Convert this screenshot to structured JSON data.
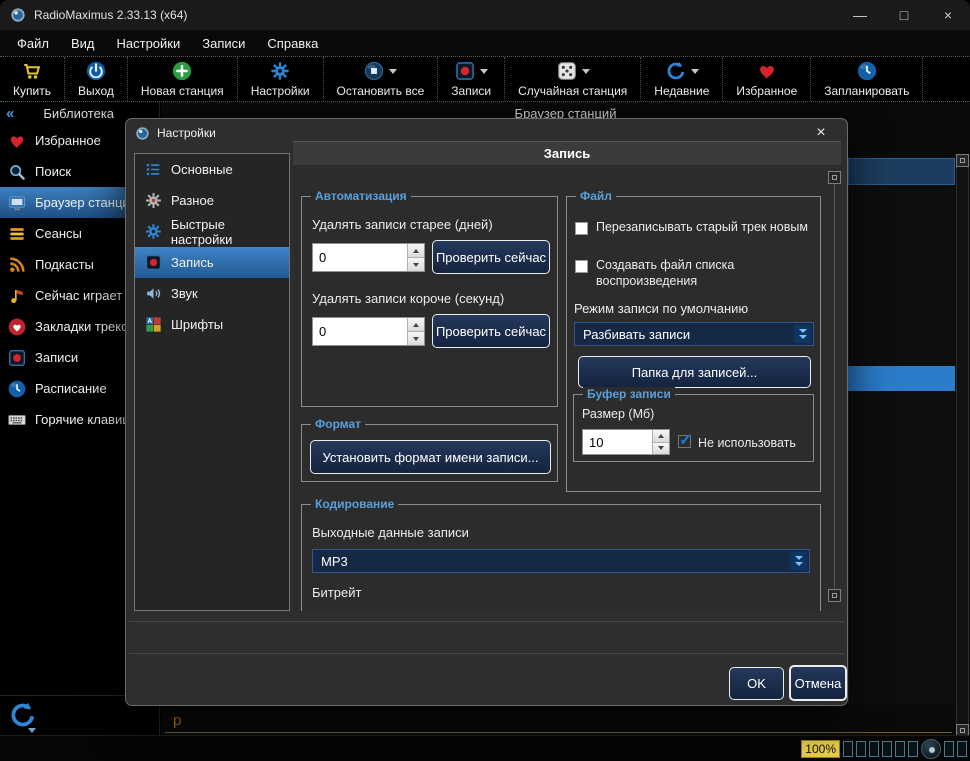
{
  "window": {
    "title": "RadioMaximus 2.33.13 (x64)",
    "minimize": "—",
    "maximize": "□",
    "close": "×"
  },
  "menubar": {
    "items": [
      {
        "label": "Файл"
      },
      {
        "label": "Вид"
      },
      {
        "label": "Настройки"
      },
      {
        "label": "Записи"
      },
      {
        "label": "Справка"
      }
    ]
  },
  "toolbar": {
    "buttons": [
      {
        "label": "Купить"
      },
      {
        "label": "Выход"
      },
      {
        "label": "Новая станция"
      },
      {
        "label": "Настройки"
      },
      {
        "label": "Остановить все",
        "dropdown": true
      },
      {
        "label": "Записи",
        "dropdown": true
      },
      {
        "label": "Случайная станция",
        "dropdown": true
      },
      {
        "label": "Недавние",
        "dropdown": true
      },
      {
        "label": "Избранное"
      },
      {
        "label": "Запланировать"
      }
    ]
  },
  "sidebar": {
    "collapse_glyph": "«",
    "title": "Библиотека",
    "items": [
      {
        "label": "Избранное"
      },
      {
        "label": "Поиск"
      },
      {
        "label": "Браузер станций",
        "selected": true
      },
      {
        "label": "Сеансы"
      },
      {
        "label": "Подкасты"
      },
      {
        "label": "Сейчас играет"
      },
      {
        "label": "Закладки треков"
      },
      {
        "label": "Записи"
      },
      {
        "label": "Расписание"
      },
      {
        "label": "Горячие клавиши"
      }
    ]
  },
  "main": {
    "header": "Браузер станций",
    "partial_glyph": "p"
  },
  "dialog": {
    "title": "Настройки",
    "close": "×",
    "page_title": "Запись",
    "tabs": [
      {
        "label": "Основные"
      },
      {
        "label": "Разное"
      },
      {
        "label": "Быстрые настройки"
      },
      {
        "label": "Запись",
        "selected": true
      },
      {
        "label": "Звук"
      },
      {
        "label": "Шрифты"
      }
    ],
    "automation": {
      "title": "Автоматизация",
      "delete_older_label": "Удалять записи старее (дней)",
      "delete_older_value": "0",
      "check_now_1": "Проверить сейчас",
      "delete_shorter_label": "Удалять записи короче (секунд)",
      "delete_shorter_value": "0",
      "check_now_2": "Проверить сейчас"
    },
    "format": {
      "title": "Формат",
      "set_name_format_button": "Установить формат имени записи..."
    },
    "file": {
      "title": "Файл",
      "overwrite_checkbox": "Перезаписывать старый трек новым",
      "playlist_checkbox": "Создавать файл списка воспроизведения",
      "default_mode_label": "Режим записи по умолчанию",
      "default_mode_value": "Разбивать записи",
      "folder_button": "Папка для записей..."
    },
    "buffer": {
      "title": "Буфер записи",
      "size_label": "Размер (Мб)",
      "size_value": "10",
      "disable_checkbox": "Не использовать",
      "check_glyph": "✓"
    },
    "encoding": {
      "title": "Кодирование",
      "output_label": "Выходные данные записи",
      "output_value": "MP3",
      "bitrate_label": "Битрейт"
    },
    "ok_button": "OK",
    "cancel_button": "Отмена"
  },
  "statusbar": {
    "zoom": "100%"
  }
}
